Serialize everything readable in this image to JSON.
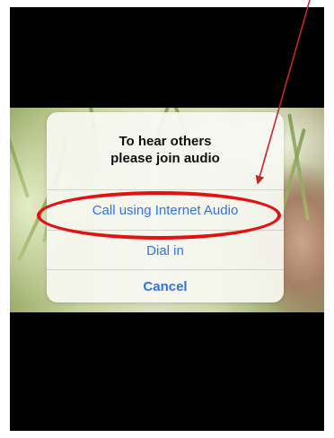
{
  "dialog": {
    "title_line1": "To hear others",
    "title_line2": "please join audio",
    "options": [
      {
        "label": "Call using Internet Audio"
      },
      {
        "label": "Dial in"
      }
    ],
    "cancel_label": "Cancel"
  },
  "colors": {
    "action_blue": "#2f74e6",
    "annotation_red": "#e51111",
    "arrow_red": "#c0282c"
  }
}
